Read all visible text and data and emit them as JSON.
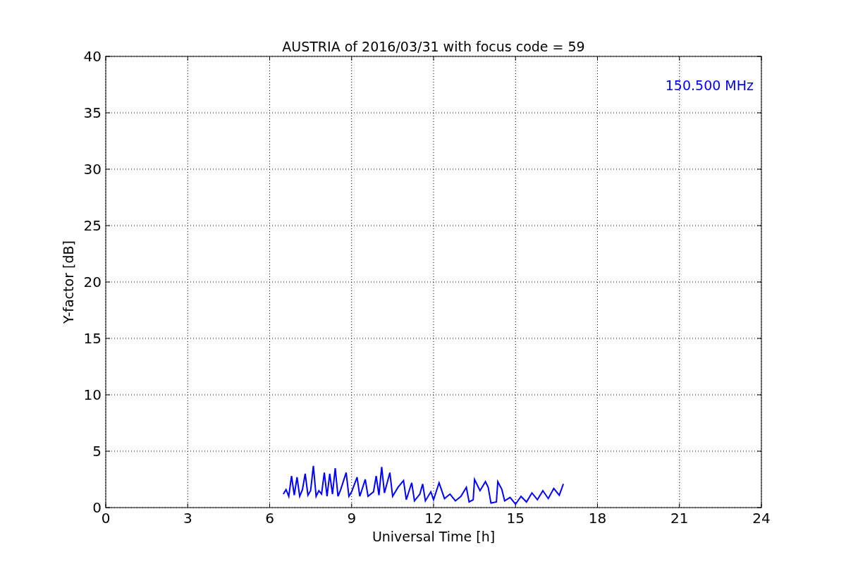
{
  "chart_data": {
    "type": "line",
    "title": "AUSTRIA of 2016/03/31 with focus code = 59",
    "xlabel": "Universal Time [h]",
    "ylabel": "Y-factor [dB]",
    "x": [
      6.5,
      6.6,
      6.7,
      6.8,
      6.9,
      7.0,
      7.1,
      7.2,
      7.3,
      7.4,
      7.5,
      7.6,
      7.7,
      7.8,
      7.9,
      8.0,
      8.1,
      8.2,
      8.3,
      8.4,
      8.5,
      8.6,
      8.8,
      8.9,
      9.0,
      9.2,
      9.3,
      9.5,
      9.6,
      9.8,
      9.9,
      10.0,
      10.1,
      10.2,
      10.4,
      10.5,
      10.7,
      10.9,
      11.0,
      11.2,
      11.3,
      11.5,
      11.6,
      11.7,
      11.9,
      12.0,
      12.2,
      12.4,
      12.6,
      12.8,
      13.0,
      13.2,
      13.3,
      13.45,
      13.5,
      13.7,
      13.9,
      14.0,
      14.1,
      14.3,
      14.35,
      14.5,
      14.6,
      14.8,
      15.0,
      15.2,
      15.4,
      15.6,
      15.8,
      16.0,
      16.2,
      16.4,
      16.6,
      16.75
    ],
    "series": [
      {
        "name": "150.500 MHz",
        "color": "#0000ff",
        "values": [
          1.2,
          1.6,
          1.0,
          2.8,
          1.1,
          2.7,
          1.0,
          1.6,
          3.0,
          1.1,
          1.5,
          3.7,
          1.0,
          1.5,
          1.2,
          3.1,
          1.0,
          3.0,
          1.2,
          3.5,
          1.0,
          1.6,
          3.1,
          1.0,
          1.4,
          2.7,
          1.0,
          2.5,
          1.0,
          1.4,
          2.8,
          1.1,
          3.6,
          1.3,
          3.1,
          1.0,
          1.8,
          2.4,
          0.7,
          2.2,
          0.6,
          1.2,
          2.1,
          0.6,
          1.4,
          0.7,
          2.2,
          0.8,
          1.2,
          0.6,
          1.0,
          1.8,
          0.5,
          0.7,
          2.5,
          1.5,
          2.3,
          1.8,
          0.4,
          0.5,
          2.3,
          1.6,
          0.6,
          0.9,
          0.3,
          1.0,
          0.5,
          1.3,
          0.7,
          1.5,
          0.8,
          1.7,
          1.1,
          2.1
        ]
      }
    ],
    "grid": true,
    "xlim": [
      0,
      24
    ],
    "ylim": [
      0,
      40
    ],
    "xticks": [
      0,
      3,
      6,
      9,
      12,
      15,
      18,
      21,
      24
    ],
    "yticks": [
      0,
      5,
      10,
      15,
      20,
      25,
      30,
      35,
      40
    ]
  }
}
